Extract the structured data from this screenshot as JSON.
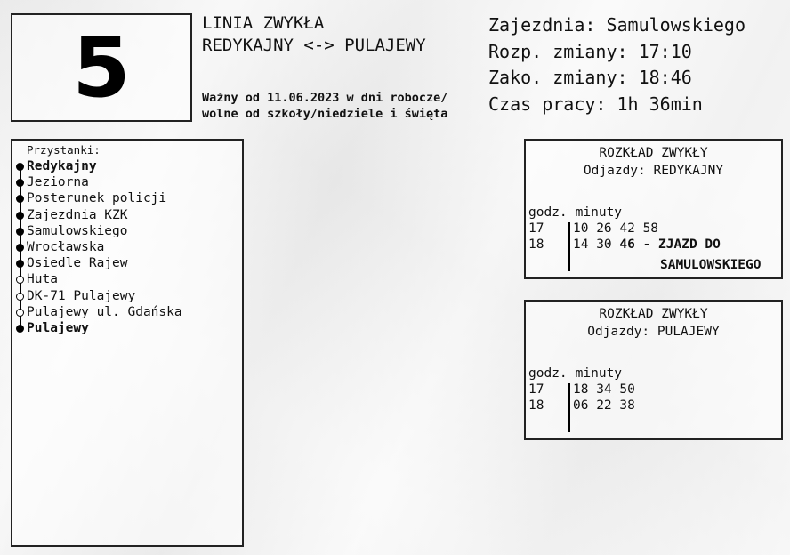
{
  "line": {
    "number": "5"
  },
  "header": {
    "type": "LINIA ZWYKŁA",
    "route": "REDYKAJNY <-> PULAJEWY",
    "validity_line1": "Ważny od 11.06.2023 w dni robocze/",
    "validity_line2": "wolne od szkoły/niedziele i święta"
  },
  "shift": {
    "depot": "Zajezdnia: Samulowskiego",
    "start": "Rozp. zmiany: 17:10",
    "end": "Zako. zmiany: 18:46",
    "worktime": "Czas pracy: 1h 36min"
  },
  "stops": {
    "title": "Przystanki:",
    "items": [
      {
        "name": "Redykajny",
        "bold": true,
        "marker": "filled"
      },
      {
        "name": "Jeziorna",
        "bold": false,
        "marker": "filled"
      },
      {
        "name": "Posterunek policji",
        "bold": false,
        "marker": "filled"
      },
      {
        "name": "Zajezdnia KZK",
        "bold": false,
        "marker": "filled"
      },
      {
        "name": "Samulowskiego",
        "bold": false,
        "marker": "filled"
      },
      {
        "name": "Wrocławska",
        "bold": false,
        "marker": "filled"
      },
      {
        "name": "Osiedle Rajew",
        "bold": false,
        "marker": "filled"
      },
      {
        "name": "Huta",
        "bold": false,
        "marker": "hollow"
      },
      {
        "name": "DK-71 Pulajewy",
        "bold": false,
        "marker": "hollow"
      },
      {
        "name": "Pulajewy ul. Gdańska",
        "bold": false,
        "marker": "hollow"
      },
      {
        "name": "Pulajewy",
        "bold": true,
        "marker": "filled"
      }
    ]
  },
  "timetables": [
    {
      "title": "ROZKŁAD ZWYKŁY",
      "direction": "Odjazdy: REDYKAJNY",
      "hours_label": "godz.",
      "minutes_label": "minuty",
      "rows": [
        {
          "hour": "17",
          "minutes": "10 26 42 58",
          "bold_minute": "",
          "note": ""
        },
        {
          "hour": "18",
          "minutes": "14 30",
          "bold_minute": "46",
          "note": "- ZJAZD DO"
        }
      ],
      "note_line2": "SAMULOWSKIEGO"
    },
    {
      "title": "ROZKŁAD ZWYKŁY",
      "direction": "Odjazdy: PULAJEWY",
      "hours_label": "godz.",
      "minutes_label": "minuty",
      "rows": [
        {
          "hour": "17",
          "minutes": "18 34 50",
          "bold_minute": "",
          "note": ""
        },
        {
          "hour": "18",
          "minutes": "06 22 38",
          "bold_minute": "",
          "note": ""
        }
      ],
      "note_line2": ""
    }
  ]
}
